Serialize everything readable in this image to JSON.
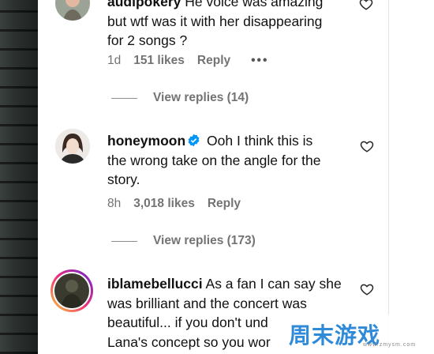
{
  "comments": [
    {
      "username": "audipokery",
      "verified": false,
      "text_lines": [
        "He voice was amazing",
        "but wtf was it with her disappearing",
        "for 2 songs ?"
      ],
      "time": "1d",
      "likes": "151 likes",
      "reply_label": "Reply",
      "more_label": "•••",
      "view_replies": "View replies (14)",
      "avatar_icon": "avatar-woman-smiling"
    },
    {
      "username": "honeymoon",
      "verified": true,
      "text_lines": [
        "Ooh I think this is",
        "the wrong take on the angle for the",
        "story."
      ],
      "time": "8h",
      "likes": "3,018 likes",
      "reply_label": "Reply",
      "view_replies": "View replies (173)",
      "avatar_icon": "avatar-woman-portrait"
    },
    {
      "username": "iblamebellucci",
      "verified": false,
      "text_lines": [
        "As a fan I can say she",
        "was brilliant and the concert was",
        "beautiful... if you don't und",
        "Lana's concept so you wor"
      ],
      "avatar_icon": "avatar-story-ring"
    }
  ],
  "icons": {
    "like": "heart-outline-icon",
    "verified": "verified-badge-icon"
  },
  "colors": {
    "verified_blue": "#0095f6",
    "meta_gray": "#737373",
    "watermark_blue": "#2f8ad8"
  },
  "watermark": {
    "text": "周末游戏",
    "url": "www.zmysm.com"
  }
}
